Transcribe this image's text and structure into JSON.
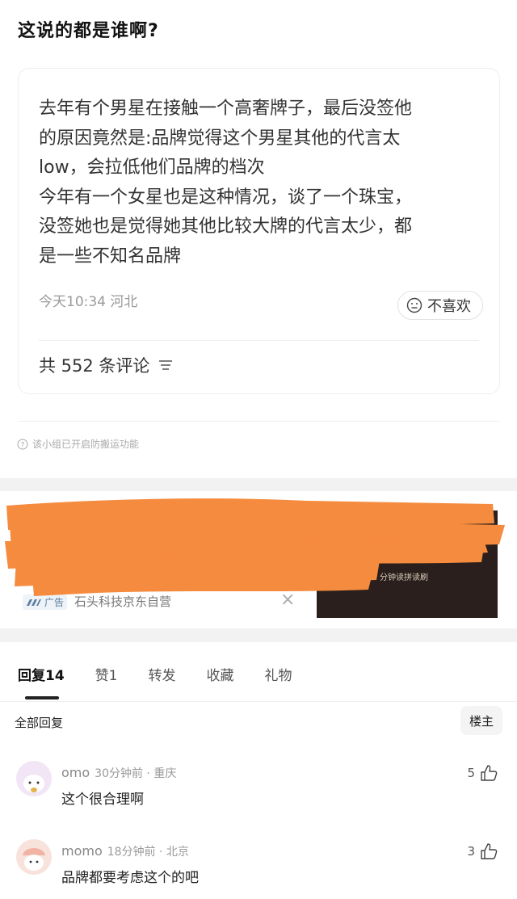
{
  "title": "这说的都是谁啊?",
  "post": {
    "lines": [
      "去年有个男星在接触一个高奢牌子，最后没签他",
      "的原因竟然是:品牌觉得这个男星其他的代言太",
      "low，会拉低他们品牌的档次",
      "今年有一个女星也是这种情况，谈了一个珠宝，",
      "没签她也是觉得她其他比较大牌的代言太少，都",
      "是一些不知名品牌"
    ],
    "meta": "今天10:34 河北",
    "dislike_label": "不喜欢",
    "comment_count_label": "共 552 条评论"
  },
  "notice": "该小组已开启防搬运功能",
  "ad": {
    "badge": "广告",
    "source": "石头科技京东自营",
    "close_glyph": "×",
    "image_text": "分钟读拼读刷"
  },
  "tabs": [
    {
      "label": "回复",
      "count": "14"
    },
    {
      "label": "赞",
      "count": "1"
    },
    {
      "label": "转发",
      "count": ""
    },
    {
      "label": "收藏",
      "count": ""
    },
    {
      "label": "礼物",
      "count": ""
    }
  ],
  "replies_header": "全部回复",
  "op_label": "楼主",
  "comments": [
    {
      "user": "omo",
      "meta": "30分钟前 · 重庆",
      "text": "这个很合理啊",
      "likes": "5"
    },
    {
      "user": "momo",
      "meta": "18分钟前 · 北京",
      "text": "品牌都要考虑这个的吧",
      "likes": "3"
    }
  ],
  "colors": {
    "scribble": "#f58b3e",
    "accent": "#222222",
    "meta": "#999999"
  }
}
